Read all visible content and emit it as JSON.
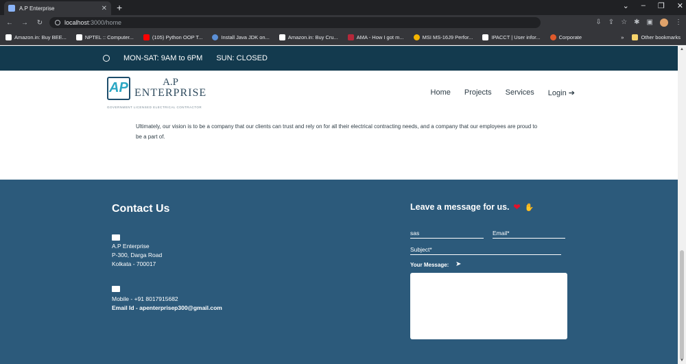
{
  "browser": {
    "tab_title": "A.P Enterprise",
    "url_host": "localhost",
    "url_path": ":3000/home",
    "bookmarks": [
      "Amazon.in: Buy BEE...",
      "NPTEL :: Computer...",
      "(105) Python OOP T...",
      "Install Java JDK on...",
      "Amazon.in: Buy Cru...",
      "AMA - How I got m...",
      "MSI MS-16J9 Perfor...",
      "IPACCT | User infor...",
      "Corporate"
    ],
    "other_bookmarks": "Other bookmarks"
  },
  "topbar": {
    "hours": "MON-SAT: 9AM to 6PM",
    "closed": "SUN: CLOSED"
  },
  "logo": {
    "line1": "A.P",
    "line2": "ENTERPRISE",
    "tagline": "GOVERNMENT LICENSED ELECTRICAL CONTRACTOR"
  },
  "nav": {
    "home": "Home",
    "projects": "Projects",
    "services": "Services",
    "login": "Login"
  },
  "about": {
    "text": "Ultimately, our vision is to be a company that our clients can trust and rely on for all their electrical contracting needs, and a company that our employees are proud to be a part of."
  },
  "contact": {
    "title": "Contact Us",
    "address": [
      "A.P Enterprise",
      "P-300, Darga Road",
      "Kolkata - 700017"
    ],
    "mobile": "Mobile - +91 8017915682",
    "email": "Email Id - apenterprisep300@gmail.com"
  },
  "form": {
    "title": "Leave a message for us.",
    "name_value": "sas",
    "email_placeholder": "Email*",
    "subject_placeholder": "Subject*",
    "message_label": "Your Message:"
  }
}
